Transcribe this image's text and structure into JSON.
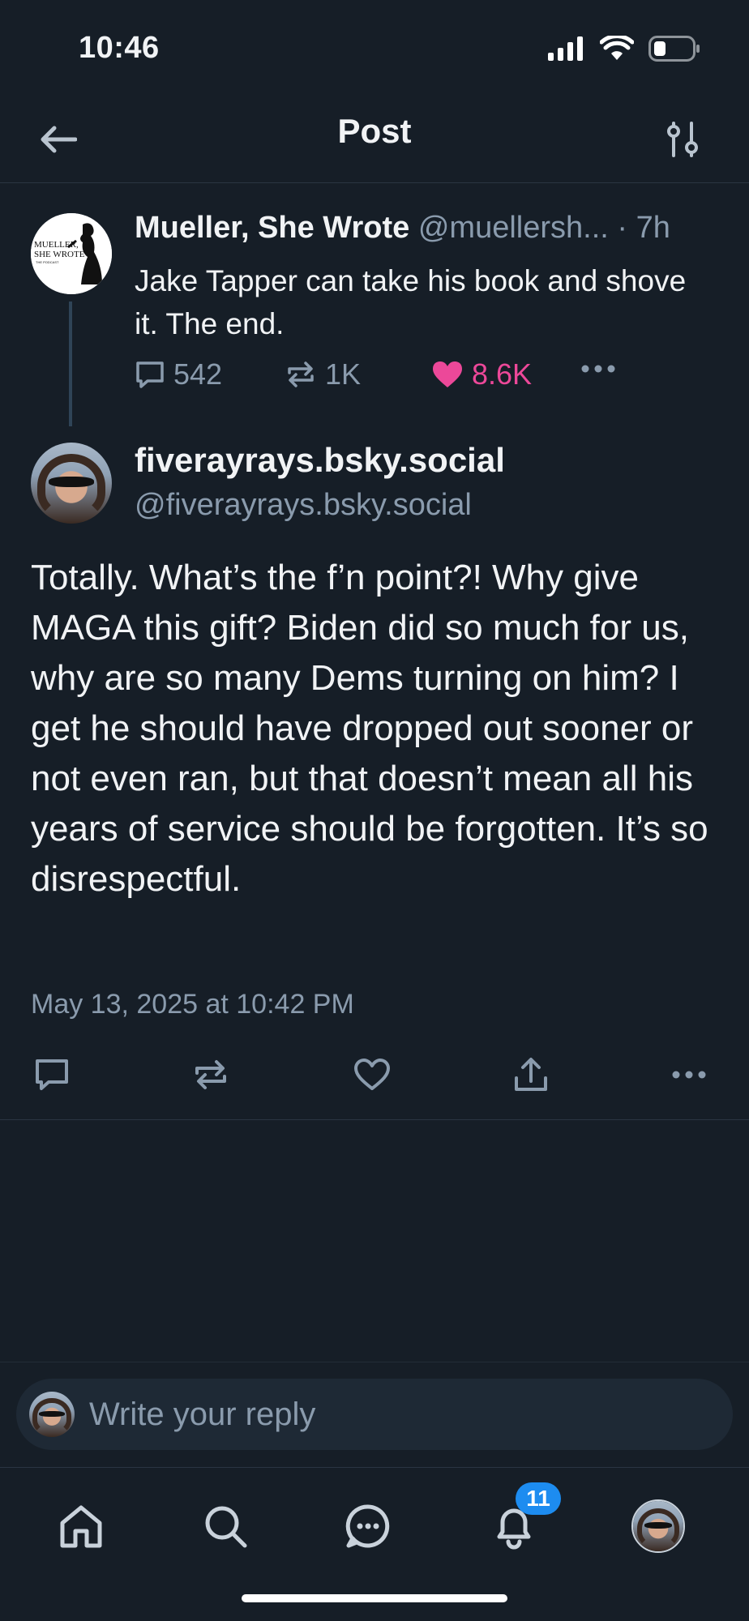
{
  "status_bar": {
    "time": "10:46"
  },
  "header": {
    "title": "Post"
  },
  "parent_post": {
    "avatar_text_line1": "MUELLER,",
    "avatar_text_line2": "SHE WROTE",
    "avatar_text_line3": "THE PODCAST",
    "author_name": "Mueller, She Wrote",
    "author_handle": "@muellersh...",
    "time_ago": "· 7h",
    "text": "Jake Tapper can take his book and shove it. The end.",
    "replies": "542",
    "reposts": "1K",
    "likes": "8.6K"
  },
  "main_post": {
    "author_name": "fiverayrays.bsky.social",
    "author_handle": "@fiverayrays.bsky.social",
    "text": "Totally. What’s the f’n point?! Why give MAGA this gift? Biden did so much for us, why are so many Dems turning on him? I get he should have dropped out sooner or not even ran, but that doesn’t mean all his years of service should be forgotten. It’s so disrespectful.",
    "timestamp": "May 13, 2025 at 10:42 PM"
  },
  "reply": {
    "placeholder": "Write your reply"
  },
  "bottom_nav": {
    "notifications_badge": "11"
  },
  "colors": {
    "background": "#161e27",
    "muted_text": "#8a9bad",
    "like_pink": "#ec4899",
    "badge_blue": "#1d8cf0",
    "thread_line": "#2f4457"
  },
  "icons": [
    "signal-icon",
    "wifi-icon",
    "battery-icon",
    "back-arrow-icon",
    "sliders-icon",
    "comment-icon",
    "repost-icon",
    "heart-icon",
    "more-icon",
    "share-icon",
    "home-icon",
    "search-icon",
    "chat-icon",
    "bell-icon"
  ]
}
